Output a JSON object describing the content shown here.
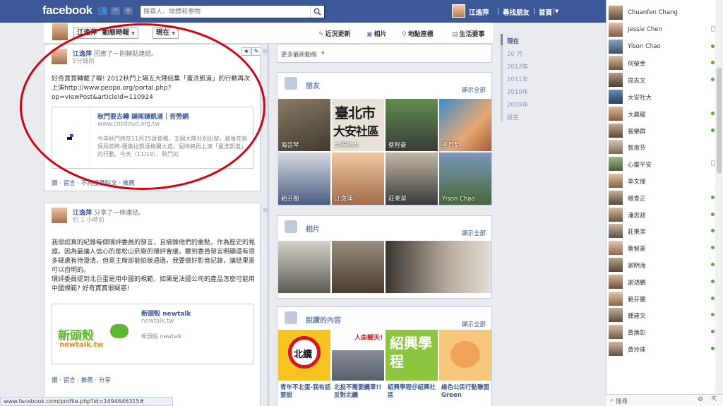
{
  "topbar": {
    "logo": "facebook",
    "search_placeholder": "搜尋人、地標和事物",
    "user_name": "江逸萍",
    "find_friends": "尋找朋友",
    "home": "首頁"
  },
  "timeline_header": {
    "name": "江逸萍",
    "feed_dropdown": "動態時報",
    "now_dropdown": "現在",
    "tabs": [
      {
        "icon": "✎",
        "label": "近況更新"
      },
      {
        "icon": "▣",
        "label": "相片"
      },
      {
        "icon": "⚲",
        "label": "地點座標"
      },
      {
        "icon": "▤",
        "label": "生活要事"
      }
    ]
  },
  "posts": [
    {
      "user": "江逸萍",
      "action": "回應了一則轉貼連結。",
      "time": "9分鐘前",
      "text": "好奇寶寶轉載了喔! 2012秋鬥上場五大陣結集「蛋洗凱道」的行動再次上演http://www.peopo.org/portal.php?op=viewPost&articleId=110924",
      "link_title": "秋鬥要去轉 鏈尾鏈凱道｜苦勞網",
      "link_url": "www.coolloud.org.tw",
      "link_desc": "今年秋鬥將在11月25號登場，五個大隊分別出發，最後在勞保局前終-匯集往凱達格蘭大道，屆時將再上演「蛋洗凱道」的行動。今天（11/19），秋鬥的",
      "actions": "讚 · 留言 · 不再接獲貼文 · 推薦"
    },
    {
      "user": "江逸萍",
      "action": "分享了一條連結。",
      "time": "約 1 小時前",
      "text": "我很認真的紀錄每個環評委員的發言，且摘錄他們的重點，作為歷史的見證。因為最讓人信心的是松山菸廠的環評會議，聽到委員發言明顯還有很多疑慮有待澄清，但是主席卻能拍板通過，我要做好影音記錄，讓結果是可以自明的。\n環評委員提到北巨蛋是用中國的規範，如果是法國公司的產品怎麼可能用中國規範? 好奇寶寶很疑惑!",
      "link_title": "新頭殼 newtalk",
      "link_url": "newtalk.tw",
      "link_desc": "新頭殼 newtalk",
      "logo_text": "新頭殼",
      "logo_sub": "newtalk.tw",
      "actions": "讚 · 留言 · 推薦 · 分享"
    }
  ],
  "more_stories": "更多最新動態",
  "friends": {
    "title": "朋友",
    "see_all": "顯示全部",
    "items": [
      "海芸琴",
      "大安社大",
      "蔡智豪",
      "吳月靜",
      "賴芬蘭",
      "江逸萍",
      "莊秉潔",
      "Yison Chao"
    ],
    "tile_texts": [
      "臺北市",
      "大安社區"
    ]
  },
  "photos": {
    "title": "相片",
    "see_all": "顯示全部"
  },
  "likes": {
    "title": "說讚的內容",
    "see_all": "顯示全部",
    "captions": [
      "青年不北蛋-我有話要說",
      "北投不需要纜車!! 反對北纜",
      "紹興學程＠紹興社區",
      "綠色公民行動聯盟Green"
    ],
    "tile_texts": [
      "北纜",
      "人命關天!",
      "紹興學程"
    ]
  },
  "years": [
    "現在",
    "10 月",
    "2012年",
    "2011年",
    "2010年",
    "2009年",
    "誕生"
  ],
  "chat": {
    "contacts": [
      {
        "name": "Chuanfen Chang",
        "status": "none"
      },
      {
        "name": "Jessie Chen",
        "status": "mobile"
      },
      {
        "name": "Yison Chao",
        "status": "online"
      },
      {
        "name": "何榮幸",
        "status": "online"
      },
      {
        "name": "周志文",
        "status": "online"
      },
      {
        "name": "大安社大",
        "status": "none"
      },
      {
        "name": "大晨龍",
        "status": "online"
      },
      {
        "name": "張樂群",
        "status": "online"
      },
      {
        "name": "張淑芬",
        "status": "none"
      },
      {
        "name": "心靈平安",
        "status": "mobile"
      },
      {
        "name": "李文傑",
        "status": "none"
      },
      {
        "name": "楊青正",
        "status": "online"
      },
      {
        "name": "潘忠政",
        "status": "online"
      },
      {
        "name": "莊秉潔",
        "status": "online"
      },
      {
        "name": "蔡智豪",
        "status": "online"
      },
      {
        "name": "謝明海",
        "status": "online"
      },
      {
        "name": "謝鴻鵬",
        "status": "online"
      },
      {
        "name": "賴芬蘭",
        "status": "online"
      },
      {
        "name": "鍾建文",
        "status": "online"
      },
      {
        "name": "黃煥彰",
        "status": "online"
      },
      {
        "name": "黃玲珠",
        "status": "online"
      }
    ],
    "search_label": "搜尋"
  },
  "status_url": "www.facebook.com/profile.php?id=1494646315#",
  "colors": {
    "brand": "#3b5998",
    "annotation": "#d9000b",
    "online": "#42b72a"
  }
}
